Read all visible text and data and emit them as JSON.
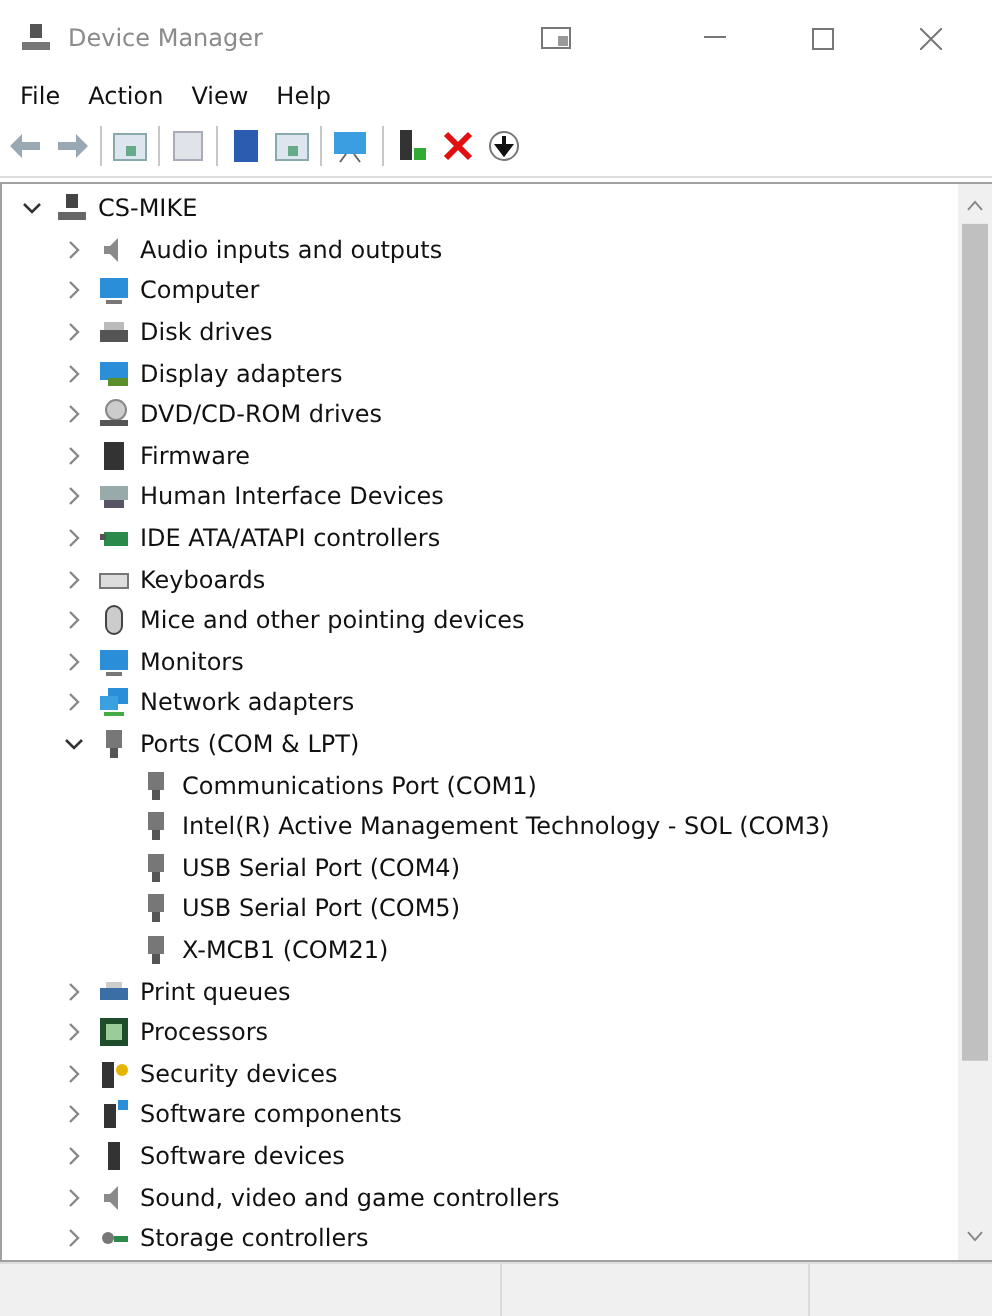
{
  "window": {
    "title": "Device Manager"
  },
  "menu": [
    {
      "label": "File"
    },
    {
      "label": "Action"
    },
    {
      "label": "View"
    },
    {
      "label": "Help"
    }
  ],
  "tree": {
    "label": "CS-MIKE",
    "expanded": true,
    "children": [
      {
        "label": "Audio inputs and outputs",
        "expanded": false
      },
      {
        "label": "Computer",
        "expanded": false
      },
      {
        "label": "Disk drives",
        "expanded": false
      },
      {
        "label": "Display adapters",
        "expanded": false
      },
      {
        "label": "DVD/CD-ROM drives",
        "expanded": false
      },
      {
        "label": "Firmware",
        "expanded": false
      },
      {
        "label": "Human Interface Devices",
        "expanded": false
      },
      {
        "label": "IDE ATA/ATAPI controllers",
        "expanded": false
      },
      {
        "label": "Keyboards",
        "expanded": false
      },
      {
        "label": "Mice and other pointing devices",
        "expanded": false
      },
      {
        "label": "Monitors",
        "expanded": false
      },
      {
        "label": "Network adapters",
        "expanded": false
      },
      {
        "label": "Ports (COM & LPT)",
        "expanded": true,
        "children": [
          {
            "label": "Communications Port (COM1)"
          },
          {
            "label": "Intel(R) Active Management Technology - SOL (COM3)"
          },
          {
            "label": "USB Serial Port (COM4)"
          },
          {
            "label": "USB Serial Port (COM5)"
          },
          {
            "label": "X-MCB1 (COM21)"
          }
        ]
      },
      {
        "label": "Print queues",
        "expanded": false
      },
      {
        "label": "Processors",
        "expanded": false
      },
      {
        "label": "Security devices",
        "expanded": false
      },
      {
        "label": "Software components",
        "expanded": false
      },
      {
        "label": "Software devices",
        "expanded": false
      },
      {
        "label": "Sound, video and game controllers",
        "expanded": false
      },
      {
        "label": "Storage controllers",
        "expanded": false
      }
    ]
  }
}
